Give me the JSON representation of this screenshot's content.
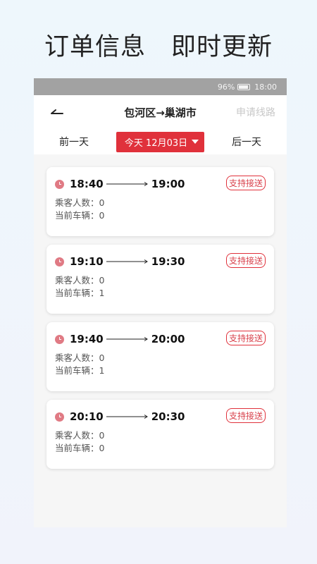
{
  "headline": {
    "left": "订单信息",
    "right": "即时更新"
  },
  "statusbar": {
    "battery": "96%",
    "time": "18:00"
  },
  "navbar": {
    "title": "包河区→巢湖市",
    "action": "申请线路"
  },
  "daybar": {
    "prev": "前一天",
    "current": "今天 12月03日",
    "next": "后一天"
  },
  "labels": {
    "passengers": "乘客人数：",
    "vehicles": "当前车辆：",
    "badge": "支持接送"
  },
  "trips": [
    {
      "depart": "18:40",
      "arrive": "19:00",
      "passengers": "0",
      "vehicles": "0"
    },
    {
      "depart": "19:10",
      "arrive": "19:30",
      "passengers": "0",
      "vehicles": "1"
    },
    {
      "depart": "19:40",
      "arrive": "20:00",
      "passengers": "0",
      "vehicles": "1"
    },
    {
      "depart": "20:10",
      "arrive": "20:30",
      "passengers": "0",
      "vehicles": "0"
    }
  ],
  "colors": {
    "accent": "#e0313b",
    "clock": "#e07a84"
  },
  "icons": {
    "back": "back-arrow-icon",
    "clock": "clock-icon",
    "battery": "battery-icon"
  }
}
